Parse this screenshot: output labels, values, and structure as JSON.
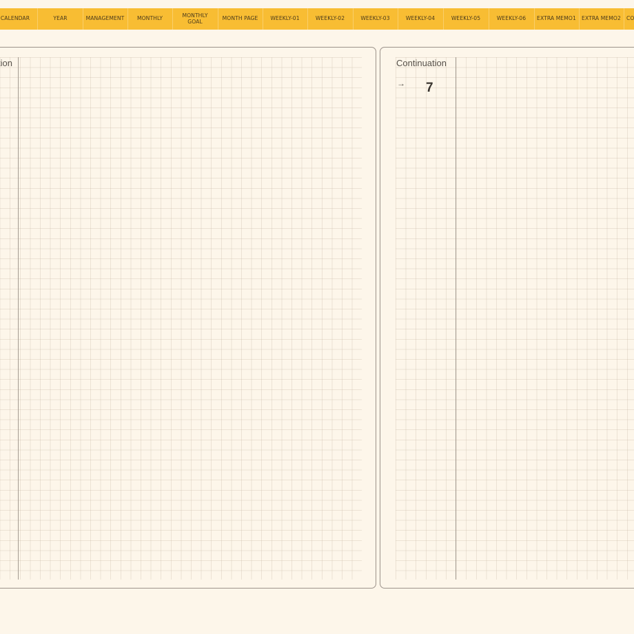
{
  "tabs": [
    {
      "label": "CALENDAR"
    },
    {
      "label": "YEAR"
    },
    {
      "label": "MANAGEMENT"
    },
    {
      "label": "MONTHLY"
    },
    {
      "label": "MONTHLY\nGOAL"
    },
    {
      "label": "MONTH PAGE"
    },
    {
      "label": "WEEKLY-01"
    },
    {
      "label": "WEEKLY-02"
    },
    {
      "label": "WEEKLY-03"
    },
    {
      "label": "WEEKLY-04"
    },
    {
      "label": "WEEKLY-05"
    },
    {
      "label": "WEEKLY-06"
    },
    {
      "label": "EXTRA MEMO1"
    },
    {
      "label": "EXTRA MEMO2"
    },
    {
      "label": "CO"
    }
  ],
  "left_page": {
    "title": "Continuation"
  },
  "right_page": {
    "title": "Continuation",
    "arrow": "→",
    "page_number": "7"
  },
  "colors": {
    "tab_bar": "#f8bd33",
    "background": "#fdf6ea",
    "border": "#9b928a"
  }
}
